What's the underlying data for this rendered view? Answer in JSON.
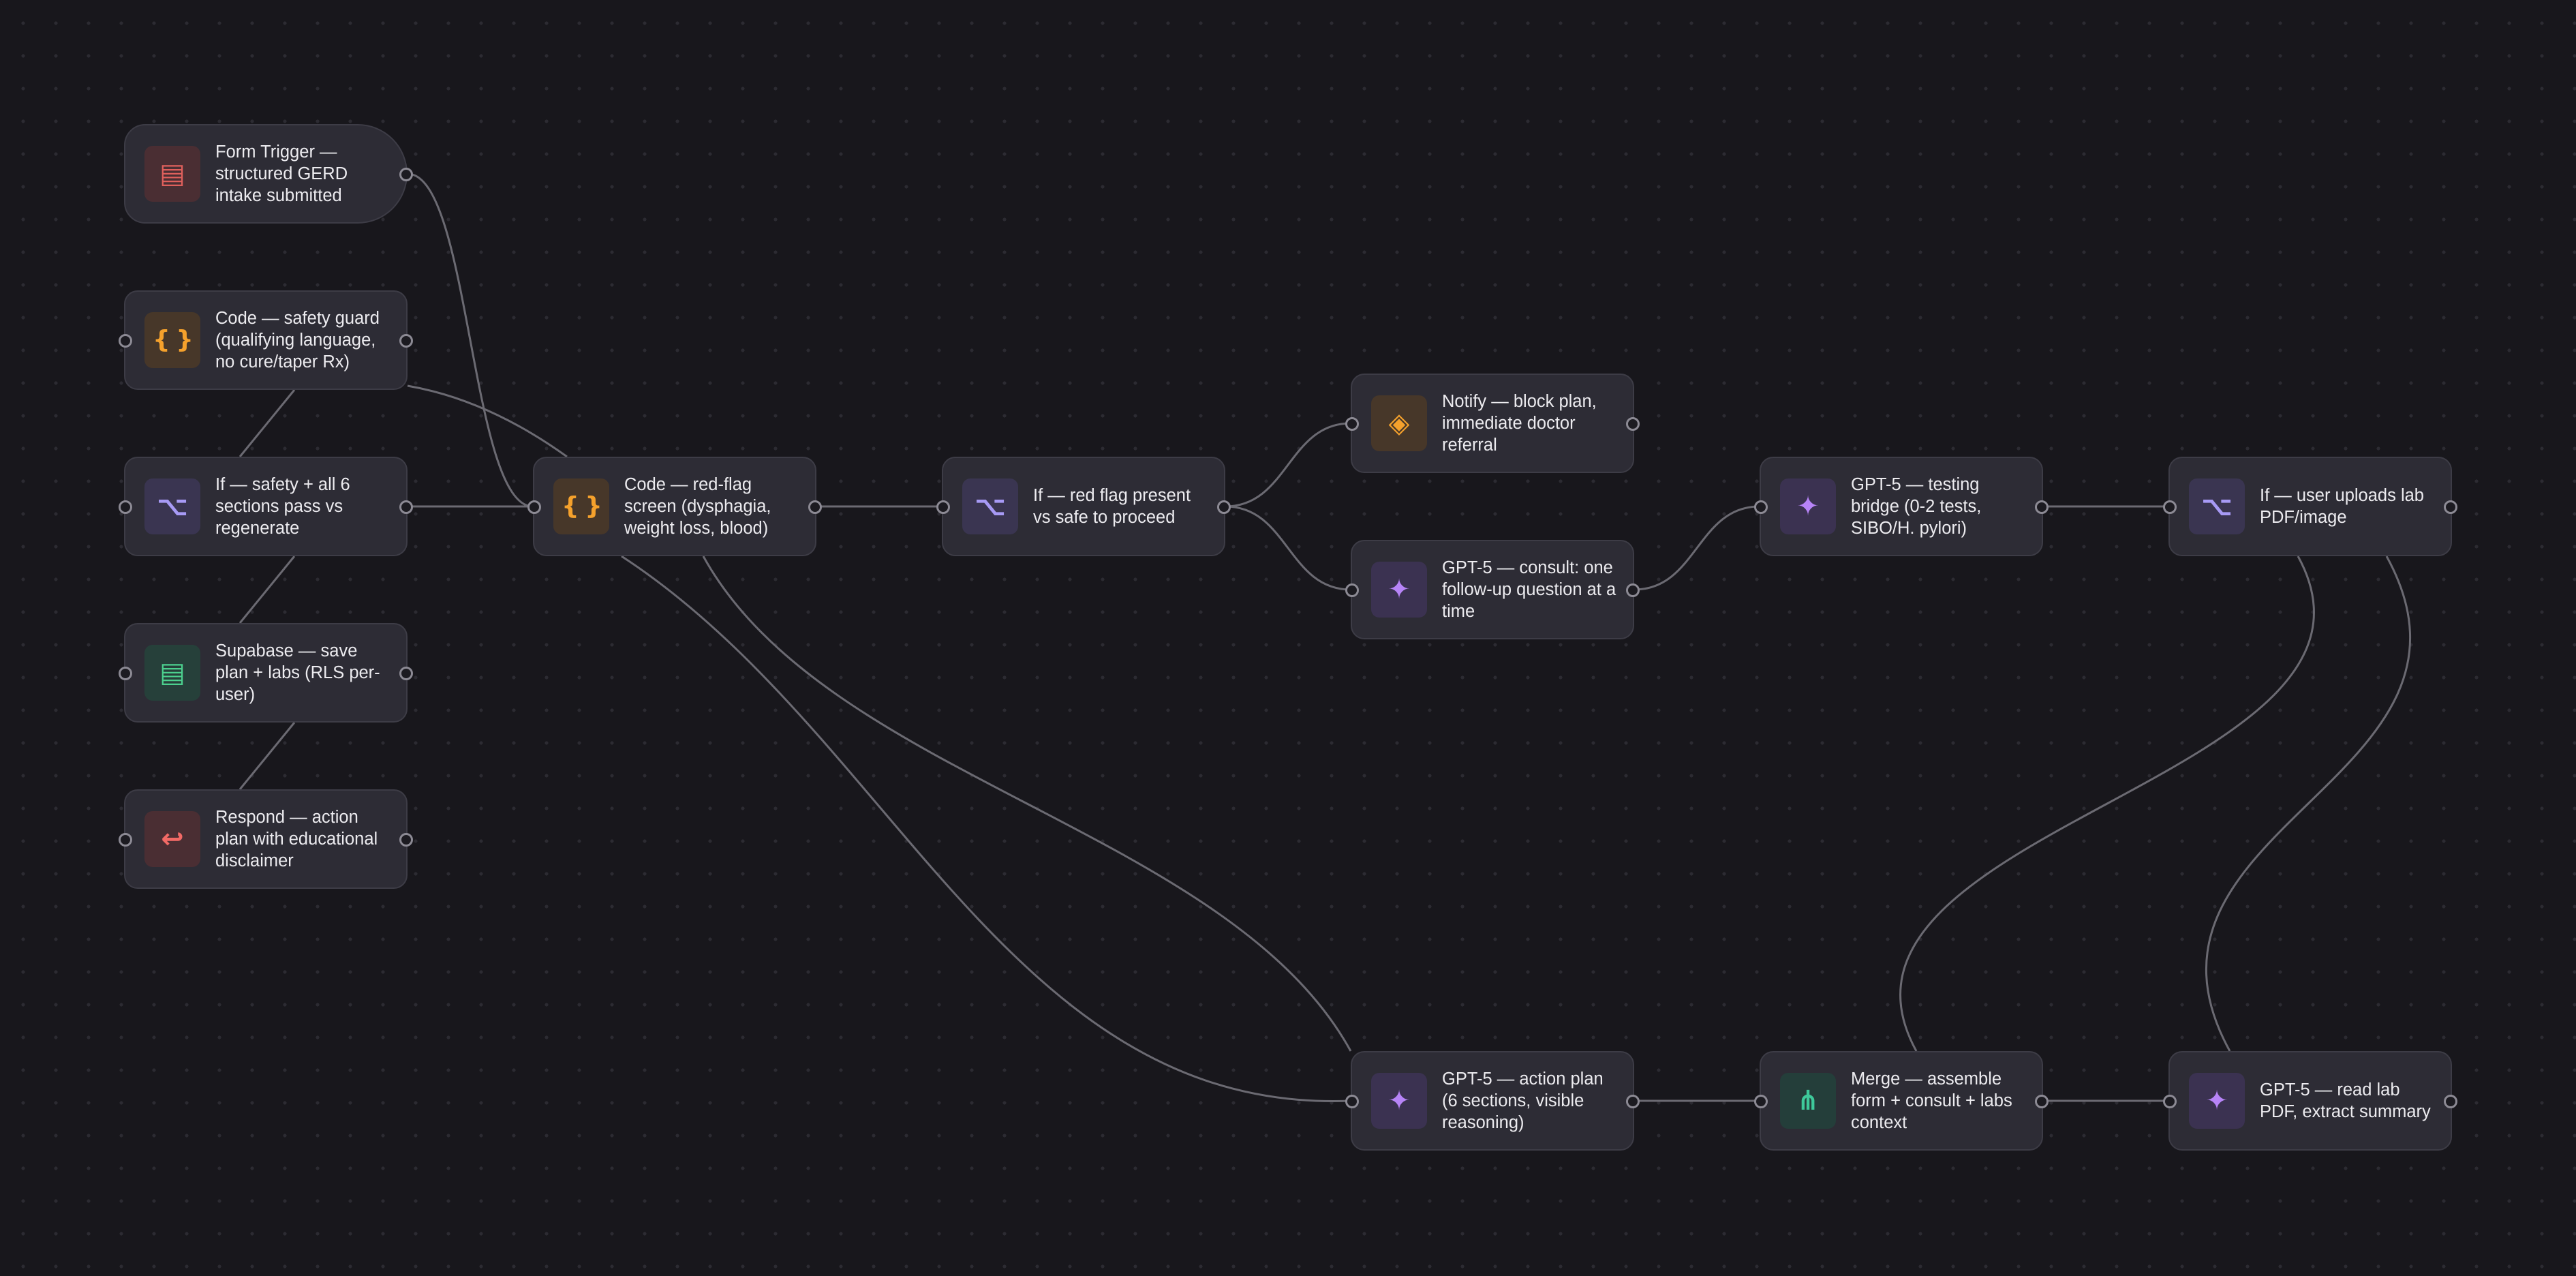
{
  "colors": {
    "background": "#18171c",
    "node_fill": "#2d2c35",
    "node_border": "#3d3c46",
    "edge": "#6b6a72",
    "text": "#ecebef"
  },
  "nodes": [
    {
      "id": "form-trigger",
      "label": "Form Trigger — structured GERD intake submitted",
      "icon": "form-icon",
      "glyph": "▤",
      "icon_color": "#e0605c",
      "icon_bg": "#4a2e33",
      "shape": "trigger",
      "ports": "out"
    },
    {
      "id": "code-safety-guard",
      "label": "Code — safety guard (qualifying language, no cure/taper Rx)",
      "icon": "code-braces-icon",
      "glyph": "{ }",
      "icon_color": "#f5a12c",
      "icon_bg": "#473729",
      "ports": "both"
    },
    {
      "id": "if-safety",
      "label": "If — safety + all 6 sections pass vs regenerate",
      "icon": "branch-icon",
      "glyph": "⌥",
      "icon_color": "#a79af5",
      "icon_bg": "#3a3551",
      "ports": "both"
    },
    {
      "id": "supabase-save",
      "label": "Supabase — save plan + labs (RLS per-user)",
      "icon": "database-icon",
      "glyph": "▤",
      "icon_color": "#4cd08e",
      "icon_bg": "#26403a",
      "ports": "both"
    },
    {
      "id": "respond",
      "label": "Respond — action plan with educational disclaimer",
      "icon": "reply-arrow-icon",
      "glyph": "↩",
      "icon_color": "#f26a66",
      "icon_bg": "#4a2e33",
      "ports": "both"
    },
    {
      "id": "code-red-flag",
      "label": "Code — red-flag screen (dysphagia, weight loss, blood)",
      "icon": "code-braces-icon",
      "glyph": "{ }",
      "icon_color": "#f5a12c",
      "icon_bg": "#473729",
      "ports": "both"
    },
    {
      "id": "if-red-flag",
      "label": "If — red flag present vs safe to proceed",
      "icon": "branch-icon",
      "glyph": "⌥",
      "icon_color": "#a79af5",
      "icon_bg": "#3a3551",
      "ports": "both"
    },
    {
      "id": "notify-block",
      "label": "Notify — block plan, immediate doctor referral",
      "icon": "notify-diamond-icon",
      "glyph": "◈",
      "icon_color": "#f5a12c",
      "icon_bg": "#473729",
      "ports": "both"
    },
    {
      "id": "gpt-consult",
      "label": "GPT-5 — consult: one follow-up question at a time",
      "icon": "sparkle-icon",
      "glyph": "✦",
      "icon_color": "#b784f7",
      "icon_bg": "#3b3251",
      "ports": "both"
    },
    {
      "id": "gpt-testing",
      "label": "GPT-5 — testing bridge (0-2 tests, SIBO/H. pylori)",
      "icon": "sparkle-icon",
      "glyph": "✦",
      "icon_color": "#b784f7",
      "icon_bg": "#3b3251",
      "ports": "both"
    },
    {
      "id": "if-upload",
      "label": "If — user uploads lab PDF/image",
      "icon": "branch-icon",
      "glyph": "⌥",
      "icon_color": "#a79af5",
      "icon_bg": "#3a3551",
      "ports": "both"
    },
    {
      "id": "gpt-action",
      "label": "GPT-5 — action plan (6 sections, visible reasoning)",
      "icon": "sparkle-icon",
      "glyph": "✦",
      "icon_color": "#b784f7",
      "icon_bg": "#3b3251",
      "ports": "both"
    },
    {
      "id": "merge",
      "label": "Merge — assemble form + consult + labs context",
      "icon": "merge-icon",
      "glyph": "⋔",
      "icon_color": "#3ec99a",
      "icon_bg": "#243e3a",
      "ports": "both"
    },
    {
      "id": "gpt-read-lab",
      "label": "GPT-5 — read lab PDF, extract summary",
      "icon": "sparkle-icon",
      "glyph": "✦",
      "icon_color": "#b784f7",
      "icon_bg": "#3b3251",
      "ports": "both"
    }
  ],
  "edges": [
    {
      "from": "form-trigger",
      "to": "code-red-flag",
      "style": "out-in"
    },
    {
      "from": "code-safety-guard",
      "to": "code-red-flag",
      "style": "out-top"
    },
    {
      "from": "code-safety-guard",
      "to": "if-safety",
      "style": "chain"
    },
    {
      "from": "if-safety",
      "to": "code-red-flag",
      "style": "out-in"
    },
    {
      "from": "if-safety",
      "to": "supabase-save",
      "style": "chain"
    },
    {
      "from": "supabase-save",
      "to": "respond",
      "style": "chain"
    },
    {
      "from": "code-red-flag",
      "to": "if-red-flag",
      "style": "out-in"
    },
    {
      "from": "if-red-flag",
      "to": "notify-block",
      "style": "out-in"
    },
    {
      "from": "if-red-flag",
      "to": "gpt-consult",
      "style": "out-in"
    },
    {
      "from": "gpt-consult",
      "to": "gpt-testing",
      "style": "out-in"
    },
    {
      "from": "gpt-testing",
      "to": "if-upload",
      "style": "out-in"
    },
    {
      "from": "code-red-flag",
      "to": "gpt-action",
      "style": "bottom-in"
    },
    {
      "from": "code-red-flag",
      "to": "gpt-action",
      "style": "bottom-top"
    },
    {
      "from": "gpt-action",
      "to": "merge",
      "style": "out-in"
    },
    {
      "from": "merge",
      "to": "gpt-read-lab",
      "style": "out-in"
    },
    {
      "from": "if-upload",
      "to": "merge",
      "style": "bottom-top"
    },
    {
      "from": "if-upload",
      "to": "gpt-read-lab",
      "style": "bottom-top"
    }
  ]
}
